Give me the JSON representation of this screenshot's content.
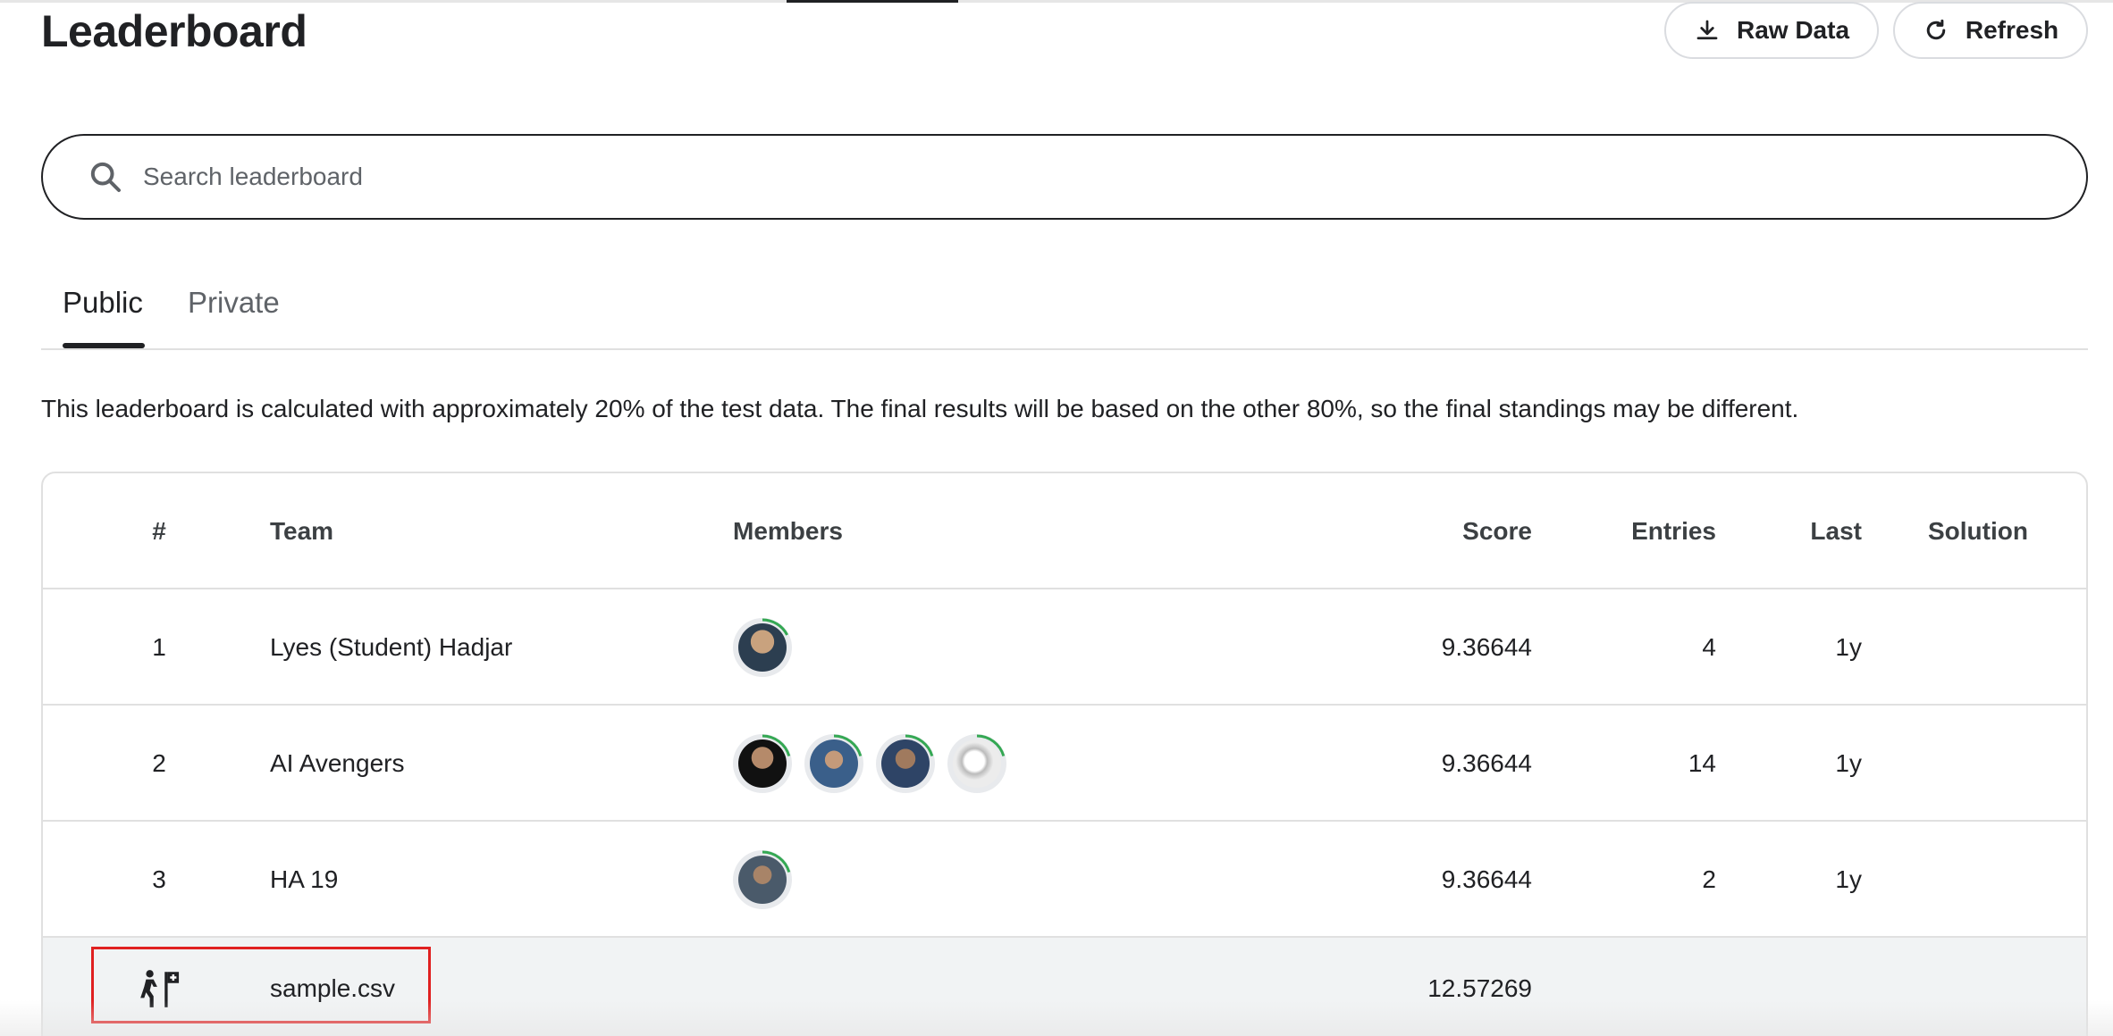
{
  "page": {
    "title": "Leaderboard",
    "raw_data_label": "Raw Data",
    "refresh_label": "Refresh"
  },
  "search": {
    "placeholder": "Search leaderboard",
    "value": ""
  },
  "tabs": [
    {
      "label": "Public",
      "active": true
    },
    {
      "label": "Private",
      "active": false
    }
  ],
  "notice": "This leaderboard is calculated with approximately 20% of the test data. The final results will be based on the other 80%, so the final standings may be different.",
  "table": {
    "columns": [
      "#",
      "Team",
      "Members",
      "Score",
      "Entries",
      "Last",
      "Solution"
    ],
    "rows": [
      {
        "rank": "1",
        "team": "Lyes (Student) Hadjar",
        "score": "9.36644",
        "entries": "4",
        "last": "1y",
        "member_count": 1
      },
      {
        "rank": "2",
        "team": "AI Avengers",
        "score": "9.36644",
        "entries": "14",
        "last": "1y",
        "member_count": 4
      },
      {
        "rank": "3",
        "team": "HA 19",
        "score": "9.36644",
        "entries": "2",
        "last": "1y",
        "member_count": 1
      }
    ],
    "sample_submission": {
      "icon": "hiker-flag-icon",
      "team": "sample.csv",
      "score": "12.57269"
    }
  },
  "icons": {
    "raw_data": "download-icon",
    "refresh": "refresh-icon",
    "search": "search-icon",
    "member": "avatar-progress-ring"
  },
  "colors": {
    "text": "#202124",
    "muted": "#5f6368",
    "border": "#e0e0e0",
    "progress_ring": "#34a853",
    "sample_row_bg": "#f1f3f4",
    "highlight": "#e02020"
  }
}
